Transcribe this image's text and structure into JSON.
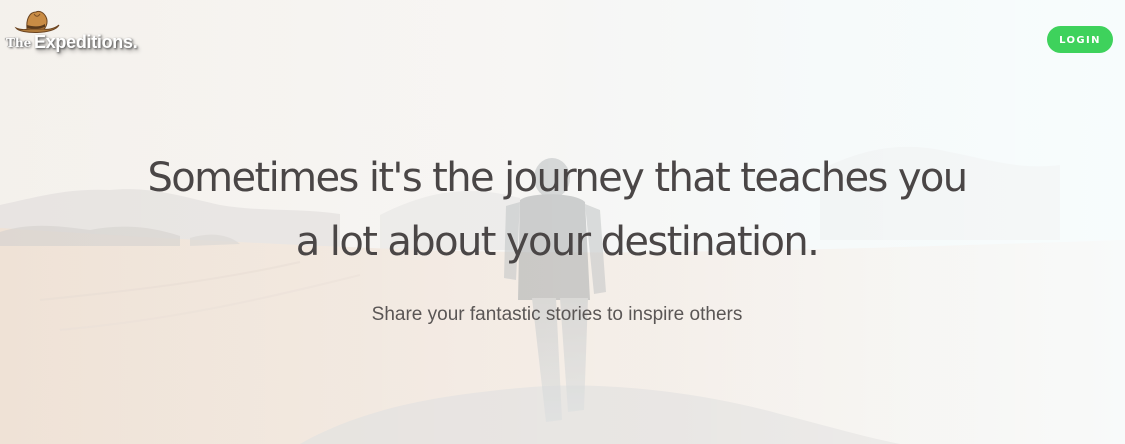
{
  "header": {
    "logo": {
      "the_text": "The",
      "brand_text": "Expeditions.",
      "icon": "cowboy-hat-icon"
    },
    "login_label": "LOGIN"
  },
  "hero": {
    "headline": "Sometimes it's the journey that teaches you a lot about your destination.",
    "subtitle": "Share your fantastic stories to inspire others"
  },
  "colors": {
    "login_button": "#3ed25c",
    "headline_text": "#4a4646",
    "subtitle_text": "#5a5655"
  }
}
